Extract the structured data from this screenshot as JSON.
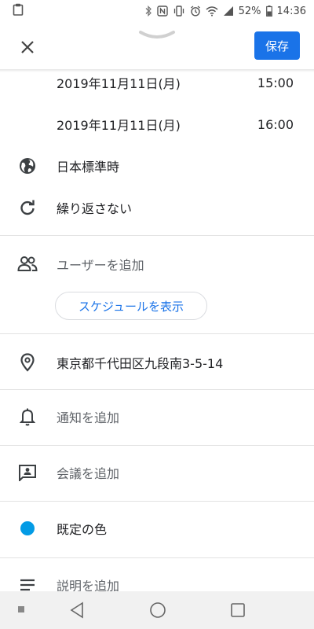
{
  "status_bar": {
    "battery_percent": "52%",
    "time": "14:36"
  },
  "app_bar": {
    "save_label": "保存"
  },
  "event": {
    "start_date": "2019年11月11日(月)",
    "start_time": "15:00",
    "end_date": "2019年11月11日(月)",
    "end_time": "16:00",
    "timezone": "日本標準時",
    "repeat": "繰り返さない"
  },
  "guests": {
    "add_label": "ユーザーを追加",
    "schedule_button": "スケジュールを表示"
  },
  "location": "東京都千代田区九段南3-5-14",
  "notification": {
    "add_label": "通知を追加"
  },
  "conference": {
    "add_label": "会議を追加"
  },
  "color": {
    "label": "既定の色",
    "value": "#039be5"
  },
  "description": {
    "add_label": "説明を追加"
  },
  "colors": {
    "accent": "#1a73e8",
    "event_color": "#039be5"
  }
}
